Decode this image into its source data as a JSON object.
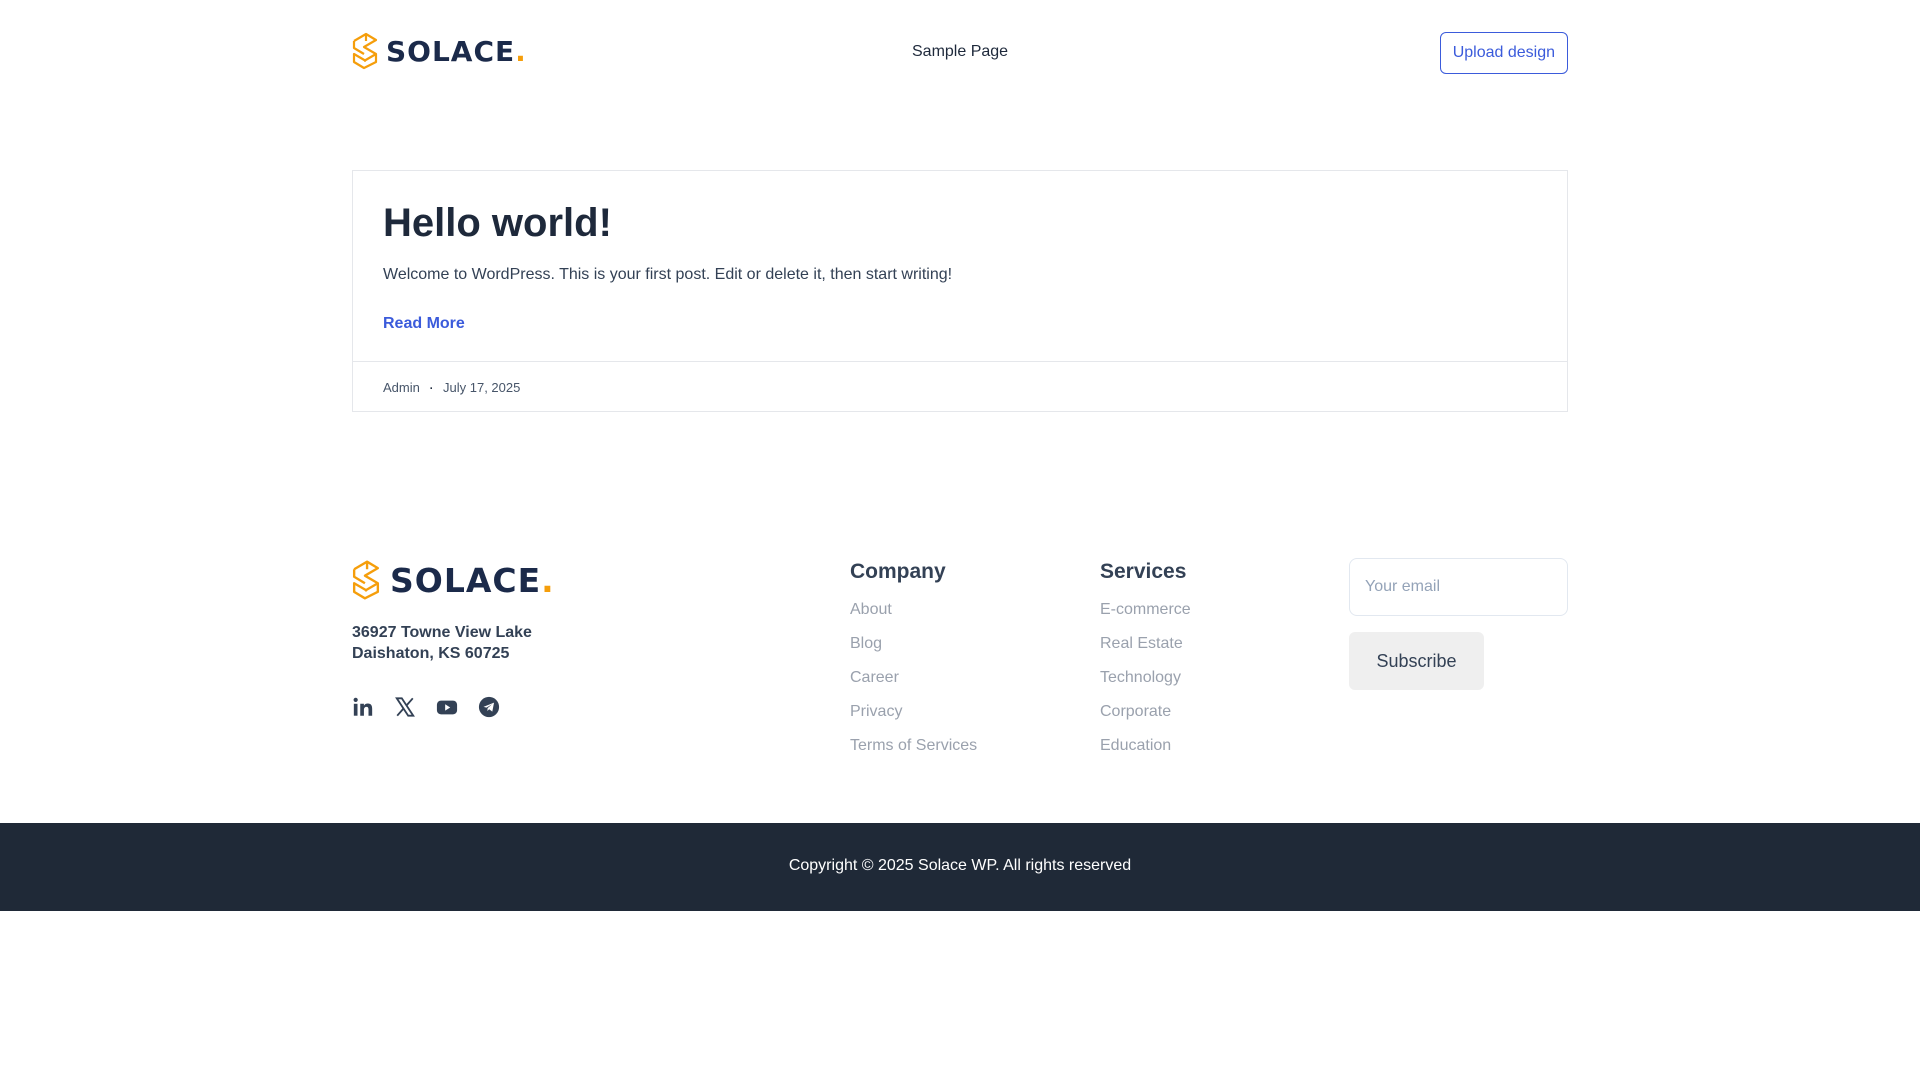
{
  "header": {
    "logo_text": "SOLACE",
    "logo_dot": ".",
    "nav": [
      {
        "label": "Sample Page"
      }
    ],
    "upload_label": "Upload design"
  },
  "post": {
    "title": "Hello world!",
    "excerpt": "Welcome to WordPress. This is your first post. Edit or delete it, then start writing!",
    "read_more": "Read More",
    "author": "Admin",
    "separator": ".",
    "date": "July 17, 2025"
  },
  "footer": {
    "logo_text": "SOLACE",
    "logo_dot": ".",
    "address_line1": "36927 Towne View Lake",
    "address_line2": "Daishaton, KS 60725",
    "socials": [
      "linkedin-icon",
      "x-twitter-icon",
      "youtube-icon",
      "telegram-icon"
    ],
    "company": {
      "title": "Company",
      "links": [
        "About",
        "Blog",
        "Career",
        "Privacy",
        "Terms of Services"
      ]
    },
    "services": {
      "title": "Services",
      "links": [
        "E-commerce",
        "Real Estate",
        "Technology",
        "Corporate",
        "Education"
      ]
    },
    "newsletter": {
      "placeholder": "Your email",
      "button": "Subscribe"
    },
    "copyright": "Copyright © 2025 Solace WP. All rights reserved"
  },
  "colors": {
    "accent": "#3b5bdb",
    "logo_orange": "#f59e0b",
    "logo_navy": "#1b2a4a",
    "footer_bar": "#1f2937"
  }
}
